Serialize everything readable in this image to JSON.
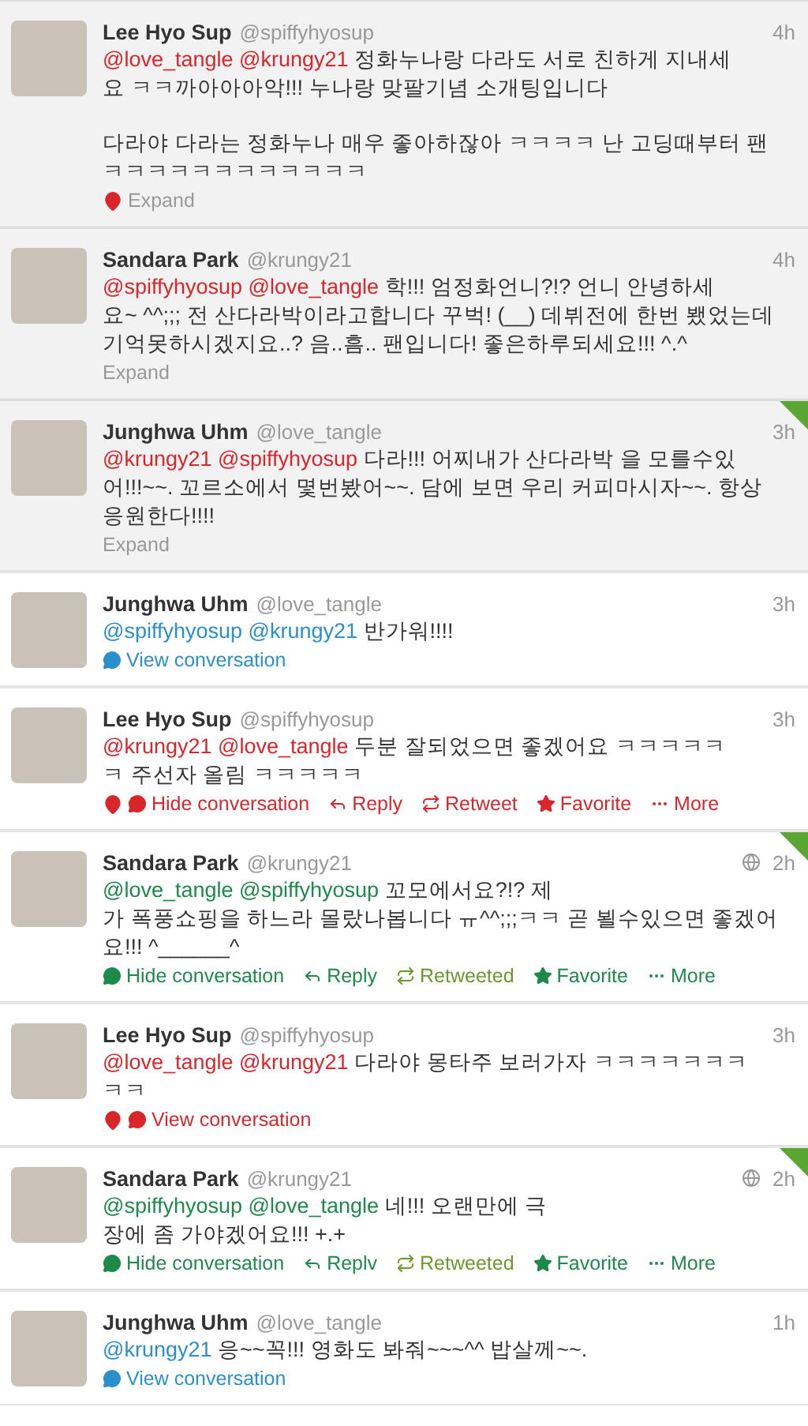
{
  "tweets": [
    {
      "name": "Lee Hyo Sup",
      "handle": "@spiffyhyosup",
      "time": "4h",
      "globe": false,
      "highlighted": true,
      "retweeted": false,
      "color": "#d9262b",
      "mentions": [
        "@love_tangle",
        "@krungy21"
      ],
      "paragraphs": [
        [
          "정화누나랑 다라도 서로 친하게 지내세",
          "요 ㅋㅋ까아아아악!!! 누나랑 맞팔기념 소개팅입니다"
        ],
        [
          "다라야 다라는 정화누나 매우 좋아하잖아 ㅋㅋㅋㅋ 난 고딩때부터 팬",
          "ㅋㅋㅋㅋㅋㅋㅋㅋㅋㅋㅋㅋ"
        ]
      ],
      "actions": [
        {
          "kind": "expand",
          "label": "Expand",
          "pin": true
        }
      ]
    },
    {
      "name": "Sandara Park",
      "handle": "@krungy21",
      "time": "4h",
      "globe": false,
      "highlighted": true,
      "retweeted": false,
      "color": "#d9262b",
      "mentions": [
        "@spiffyhyosup",
        "@love_tangle"
      ],
      "paragraphs": [
        [
          "학!!! 엄정화언니?!? 언니 안녕하세",
          "요~ ^^;;; 전 산다라박이라고합니다 꾸벅! (__) 데뷔전에 한번 뵀었는데",
          "기억못하시겠지요..? 음..흠.. 팬입니다! 좋은하루되세요!!! ^.^"
        ]
      ],
      "actions": [
        {
          "kind": "expand",
          "label": "Expand",
          "pin": false
        }
      ]
    },
    {
      "name": "Junghwa Uhm",
      "handle": "@love_tangle",
      "time": "3h",
      "globe": false,
      "highlighted": true,
      "retweeted": true,
      "color": "#d9262b",
      "mentions": [
        "@krungy21",
        "@spiffyhyosup"
      ],
      "paragraphs": [
        [
          "다라!!!  어찌내가 산다라박 을 모를수있",
          "어!!!~~. 꼬르소에서 몇번봤어~~. 담에 보면 우리 커피마시자~~. 항상",
          "응원한다!!!!"
        ]
      ],
      "actions": [
        {
          "kind": "expand",
          "label": "Expand",
          "pin": false
        }
      ]
    },
    {
      "name": "Junghwa Uhm",
      "handle": "@love_tangle",
      "time": "3h",
      "globe": false,
      "highlighted": false,
      "retweeted": false,
      "color": "#2b8fcc",
      "mentions": [
        "@spiffyhyosup",
        "@krungy21"
      ],
      "paragraphs": [
        [
          "반가워!!!!"
        ]
      ],
      "actions": [
        {
          "kind": "conversation",
          "label": "View conversation",
          "pin": false
        }
      ]
    },
    {
      "name": "Lee Hyo Sup",
      "handle": "@spiffyhyosup",
      "time": "3h",
      "globe": false,
      "highlighted": false,
      "retweeted": false,
      "color": "#d9262b",
      "mentions": [
        "@krungy21",
        "@love_tangle"
      ],
      "paragraphs": [
        [
          "두분 잘되었으면 좋겠어요 ㅋㅋㅋㅋㅋ",
          "ㅋ  주선자 올림 ㅋㅋㅋㅋㅋ"
        ]
      ],
      "actions": [
        {
          "kind": "conversation",
          "label": "Hide conversation",
          "pin": true
        },
        {
          "kind": "reply",
          "label": "Reply"
        },
        {
          "kind": "retweet",
          "label": "Retweet"
        },
        {
          "kind": "favorite",
          "label": "Favorite"
        },
        {
          "kind": "more",
          "label": "More"
        }
      ]
    },
    {
      "name": "Sandara Park",
      "handle": "@krungy21",
      "time": "2h",
      "globe": true,
      "highlighted": false,
      "retweeted": true,
      "color": "#1d8a4a",
      "mentions": [
        "@love_tangle",
        "@spiffyhyosup"
      ],
      "paragraphs": [
        [
          "꼬모에서요?!? 제",
          "가 폭풍쇼핑을 하느라 몰랐나봅니다 ㅠ^^;;;ㅋㅋ 곧 뵐수있으면 좋겠어",
          "요!!! ^______^"
        ]
      ],
      "actions": [
        {
          "kind": "conversation",
          "label": "Hide conversation",
          "pin": false
        },
        {
          "kind": "reply",
          "label": "Reply"
        },
        {
          "kind": "retweet",
          "label": "Retweeted"
        },
        {
          "kind": "favorite",
          "label": "Favorite"
        },
        {
          "kind": "more",
          "label": "More"
        }
      ]
    },
    {
      "name": "Lee Hyo Sup",
      "handle": "@spiffyhyosup",
      "time": "3h",
      "globe": false,
      "highlighted": false,
      "retweeted": false,
      "color": "#d9262b",
      "mentions": [
        "@love_tangle",
        "@krungy21"
      ],
      "paragraphs": [
        [
          "다라야 몽타주 보러가자 ㅋㅋㅋㅋㅋㅋㅋ",
          "ㅋㅋ"
        ]
      ],
      "actions": [
        {
          "kind": "conversation",
          "label": "View conversation",
          "pin": true
        }
      ]
    },
    {
      "name": "Sandara Park",
      "handle": "@krungy21",
      "time": "2h",
      "globe": true,
      "highlighted": false,
      "retweeted": true,
      "color": "#1d8a4a",
      "mentions": [
        "@spiffyhyosup",
        "@love_tangle"
      ],
      "paragraphs": [
        [
          "네!!! 오랜만에 극",
          "장에 좀 가야겠어요!!! +.+"
        ]
      ],
      "actions": [
        {
          "kind": "conversation",
          "label": "Hide conversation",
          "pin": false
        },
        {
          "kind": "reply",
          "label": "Replv"
        },
        {
          "kind": "retweet",
          "label": "Retweeted"
        },
        {
          "kind": "favorite",
          "label": "Favorite"
        },
        {
          "kind": "more",
          "label": "More"
        }
      ]
    },
    {
      "name": "Junghwa Uhm",
      "handle": "@love_tangle",
      "time": "1h",
      "globe": false,
      "highlighted": false,
      "retweeted": false,
      "color": "#2b8fcc",
      "mentions": [
        "@krungy21"
      ],
      "paragraphs": [
        [
          "응~~꼭!!!   영화도 봐줘~~~^^ 밥살께~~."
        ]
      ],
      "actions": [
        {
          "kind": "conversation",
          "label": "View conversation",
          "pin": false
        }
      ]
    }
  ]
}
